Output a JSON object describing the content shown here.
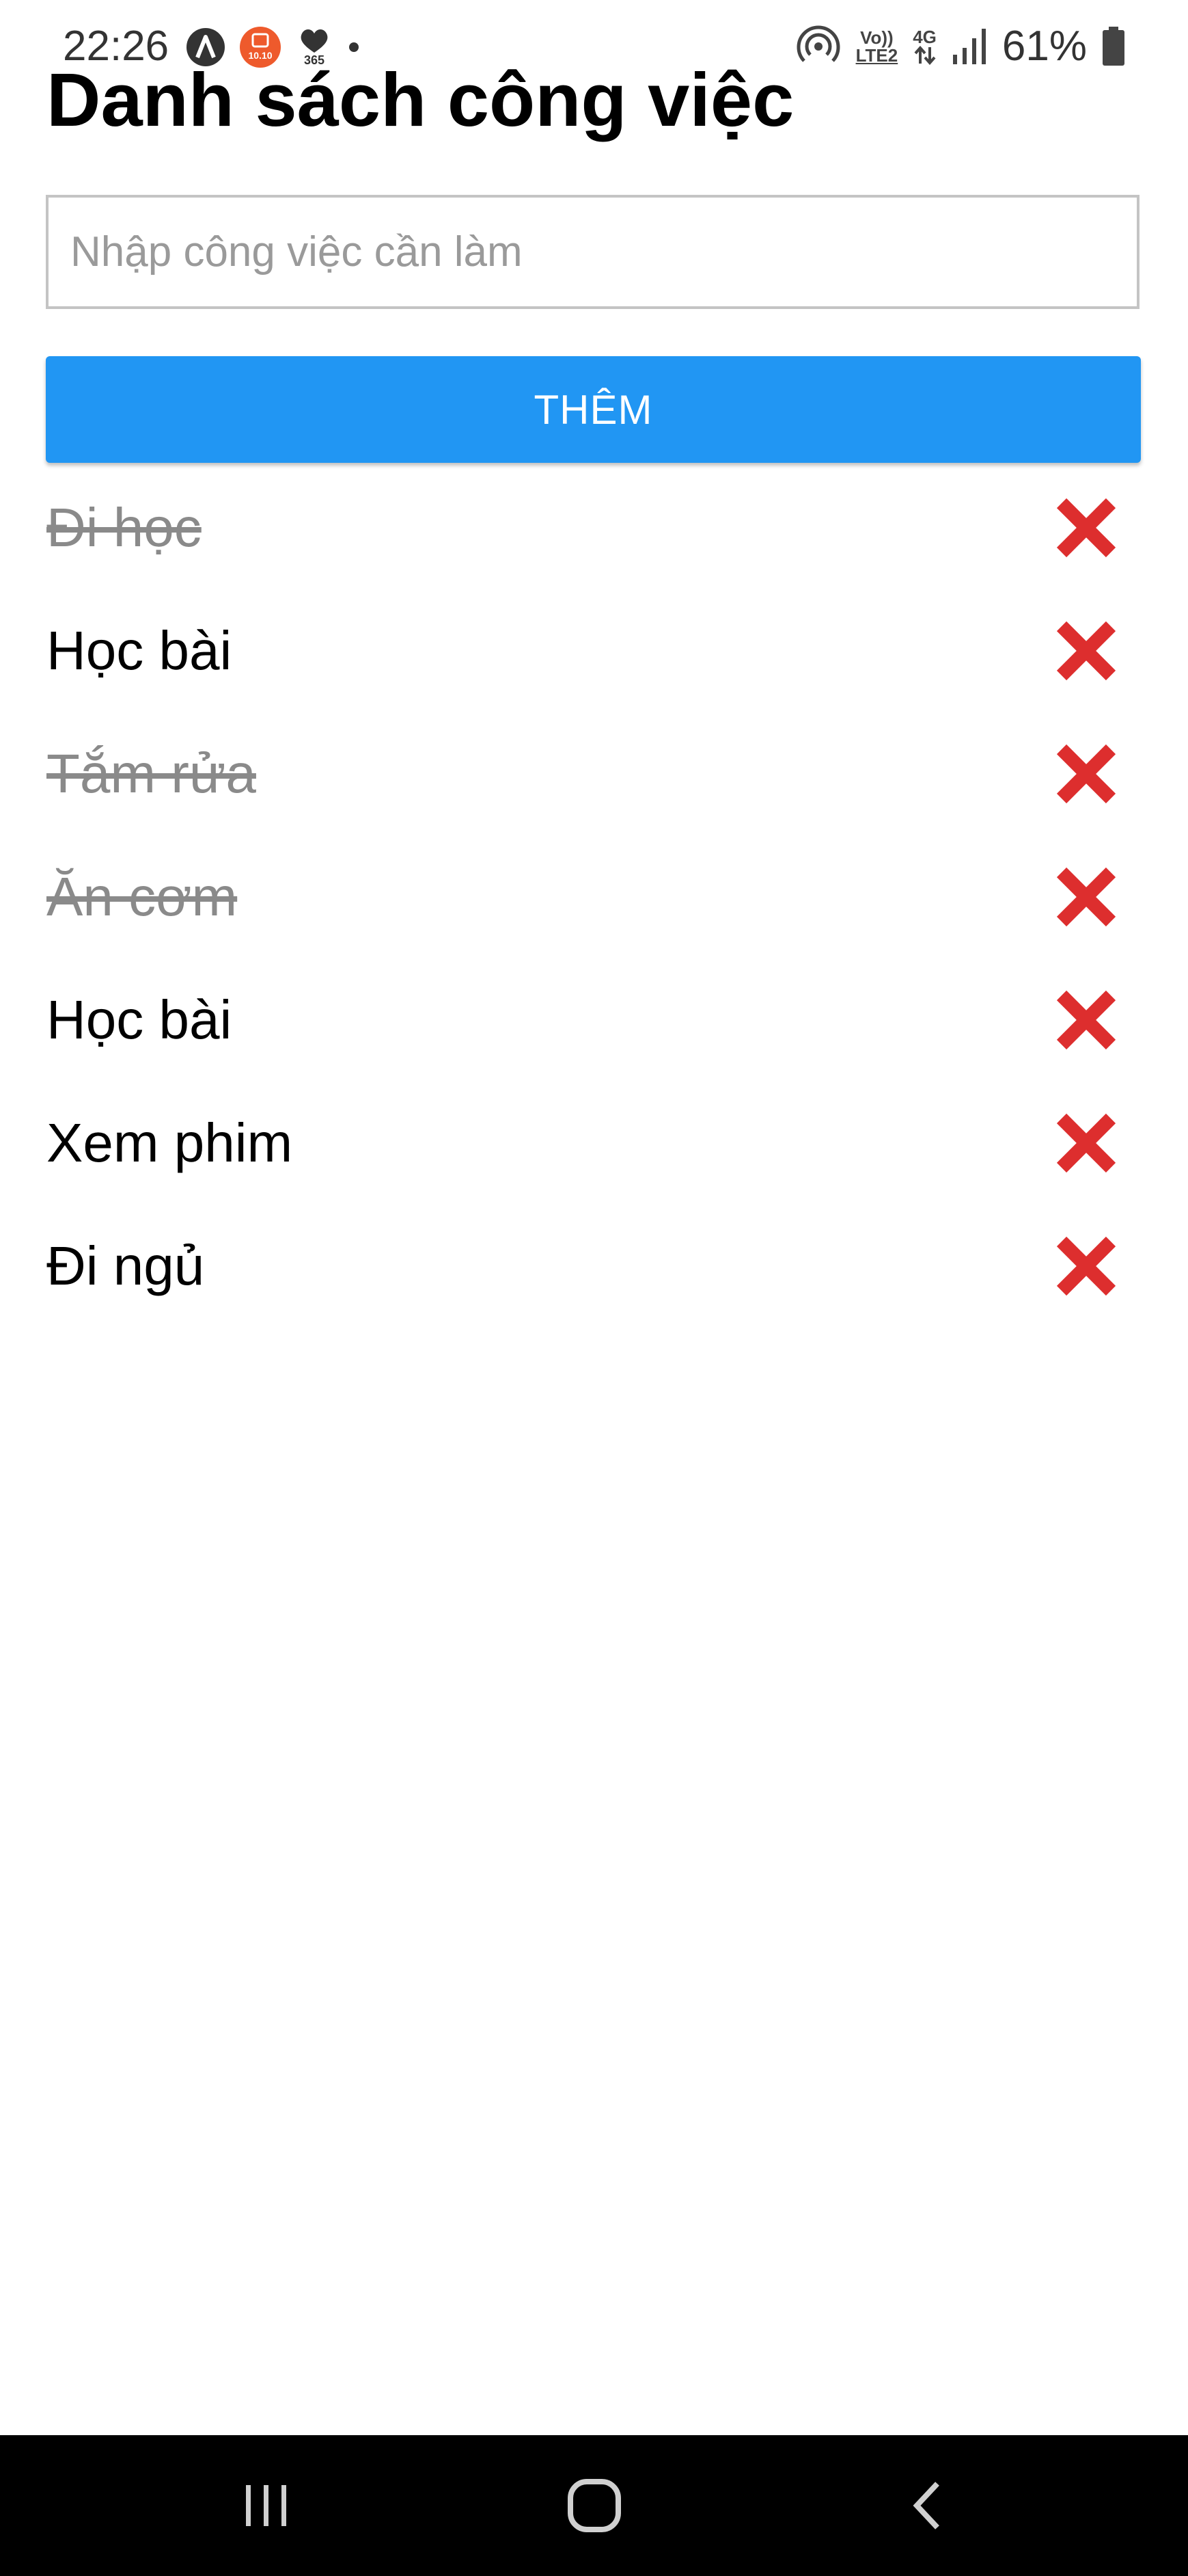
{
  "status_bar": {
    "time": "22:26",
    "notification_icons": [
      "a-circle-icon",
      "shopee-10-10-icon",
      "heart-365-icon",
      "dot-icon"
    ],
    "app_badge_text": "10.10",
    "health_badge_text": "365",
    "hotspot_icon": "hotspot-icon",
    "volte_line1": "Vo))",
    "volte_line2": "LTE2",
    "network_type": "4G",
    "signal_icon": "signal-icon",
    "battery_percent": "61%",
    "battery_icon": "battery-icon"
  },
  "header": {
    "title": "Danh sách công việc"
  },
  "form": {
    "input_placeholder": "Nhập công việc cần làm",
    "input_value": "",
    "add_button_label": "THÊM",
    "add_button_color": "#2196f3"
  },
  "tasks": [
    {
      "text": "Đi học",
      "done": true
    },
    {
      "text": "Học bài",
      "done": false
    },
    {
      "text": "Tắm rửa",
      "done": true
    },
    {
      "text": "Ăn cơm",
      "done": true
    },
    {
      "text": "Học bài",
      "done": false
    },
    {
      "text": "Xem phim",
      "done": false
    },
    {
      "text": "Đi ngủ",
      "done": false
    }
  ],
  "delete_icon": "cross-mark-icon",
  "delete_icon_color": "#dd2e2e",
  "done_text_color": "#8a8a8a",
  "navigation_bar": {
    "buttons": [
      "recent-apps-icon",
      "home-icon",
      "back-icon"
    ]
  }
}
